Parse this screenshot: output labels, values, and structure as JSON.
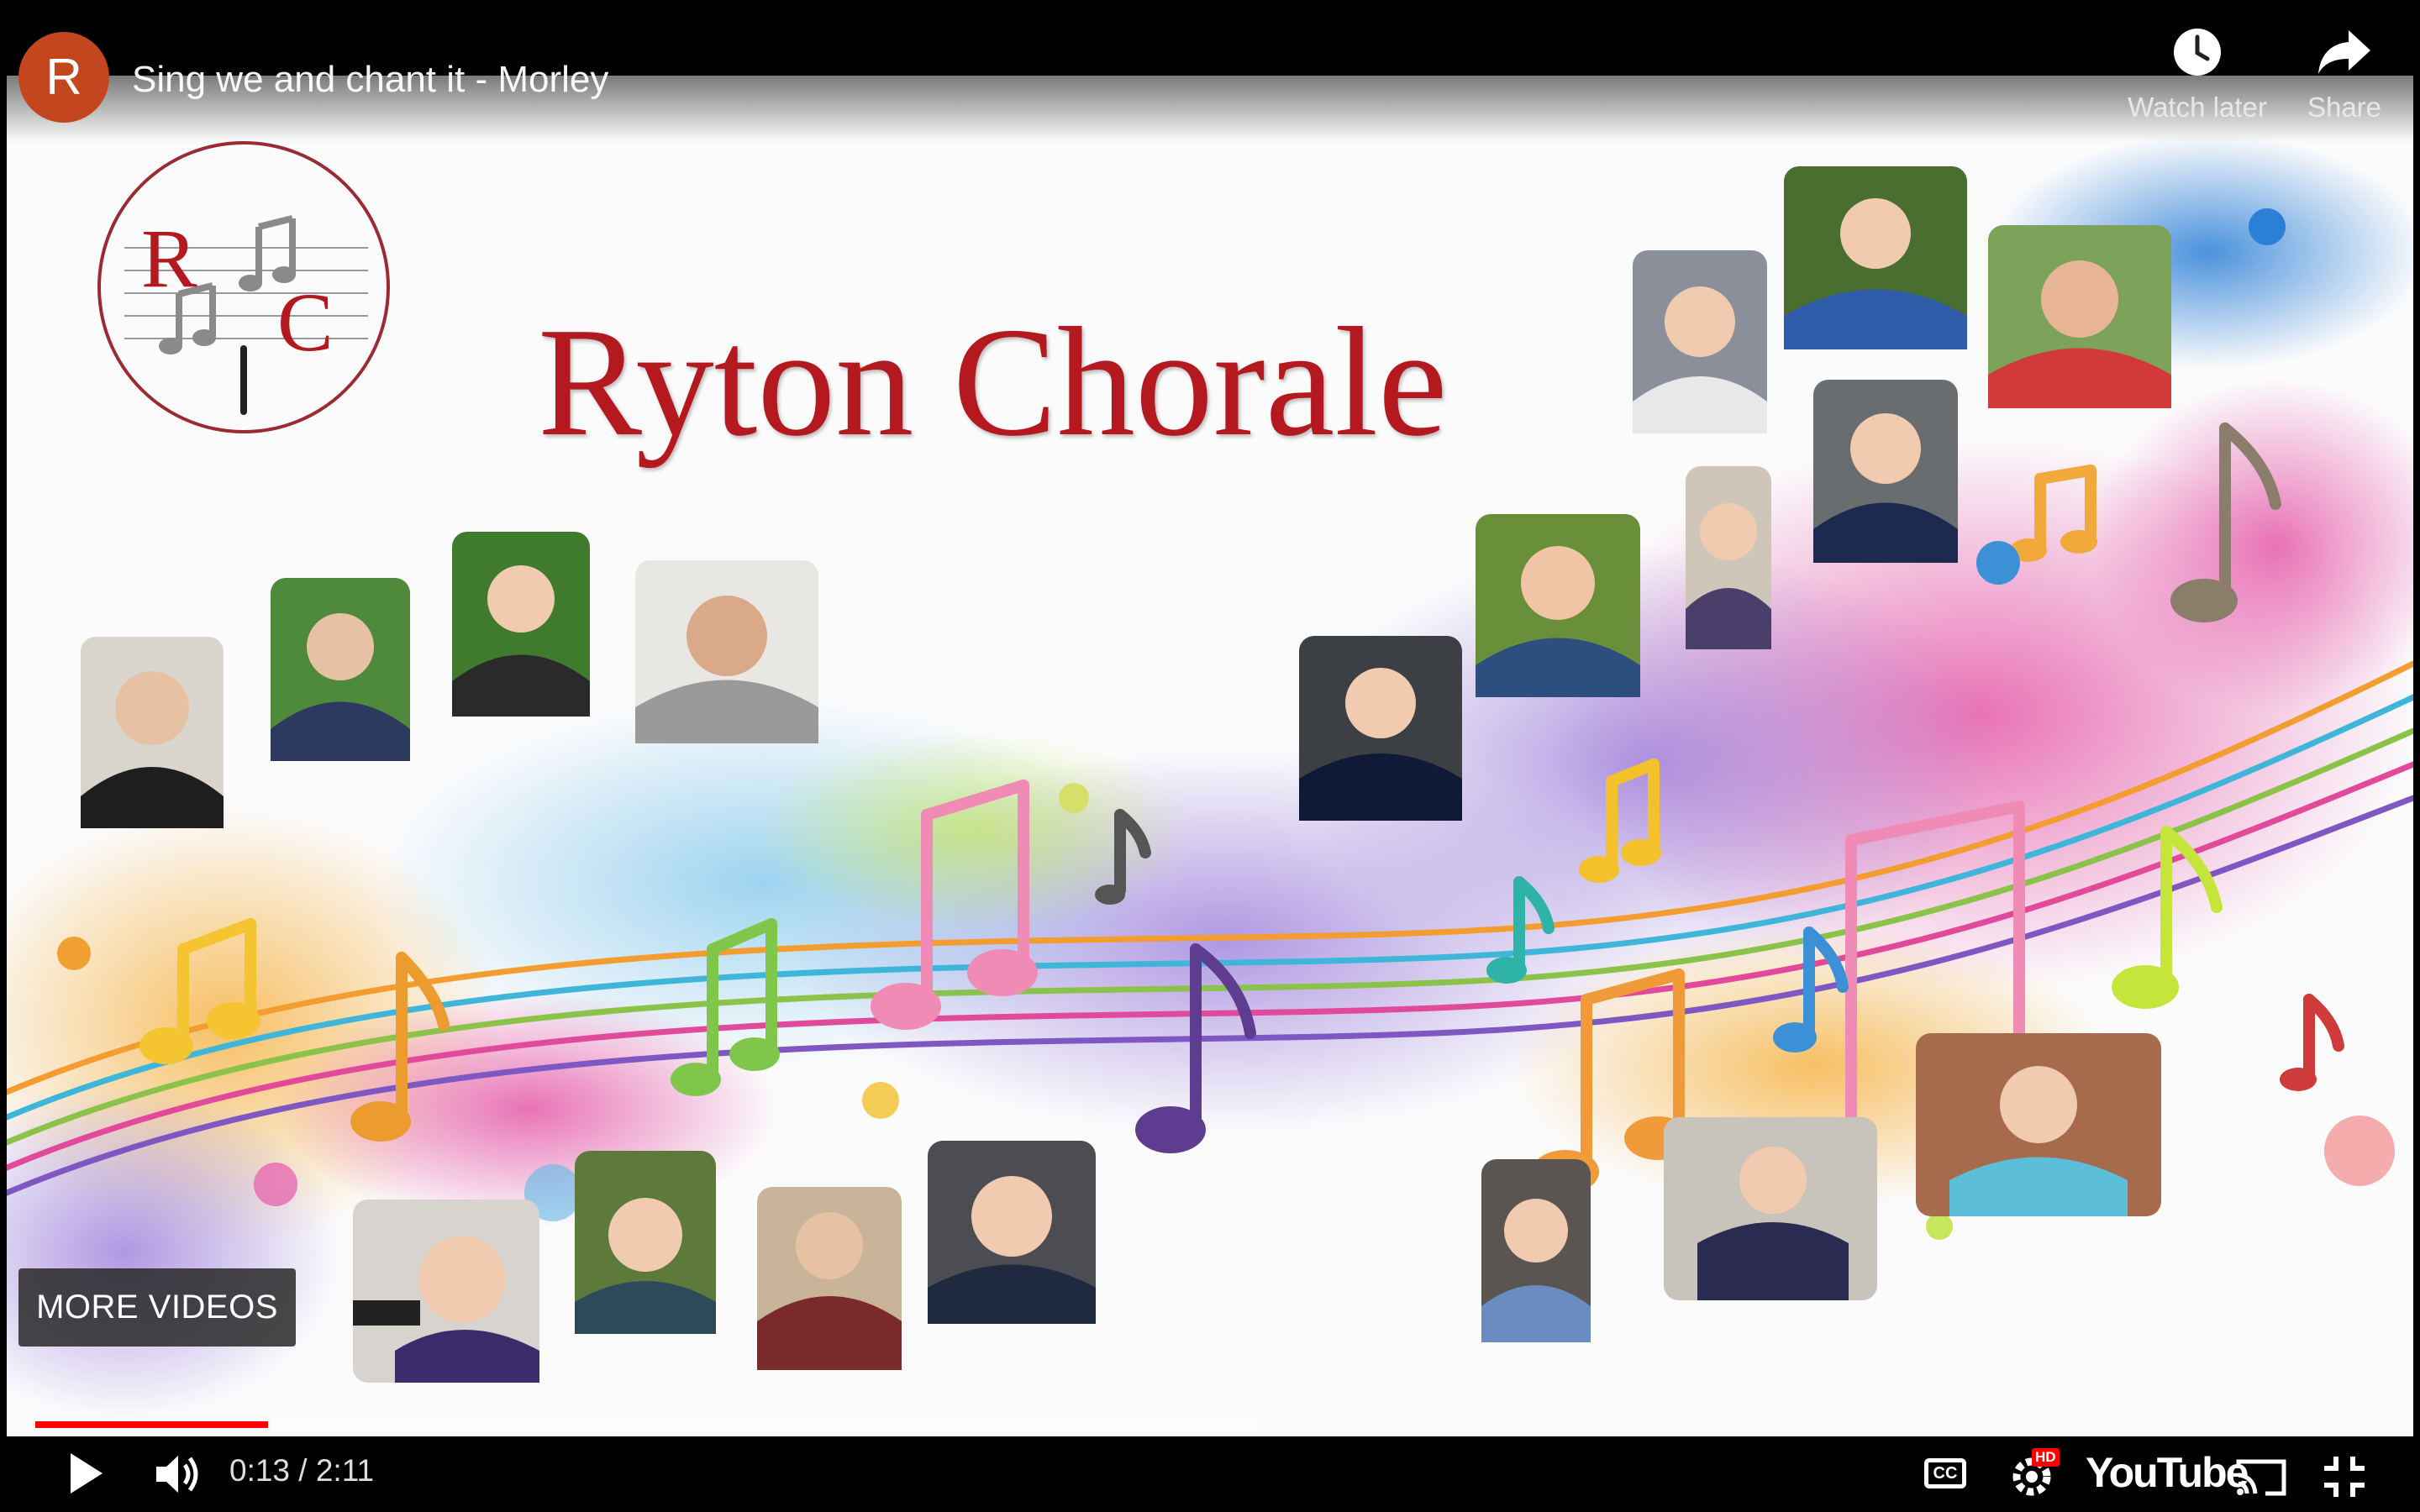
{
  "channel": {
    "avatar_letter": "R",
    "avatar_color": "#c3461f"
  },
  "video": {
    "title": "Sing we and chant it - Morley"
  },
  "top_actions": {
    "watch_later": "Watch later",
    "share": "Share"
  },
  "slide": {
    "heading": "Ryton Chorale",
    "heading_color": "#b3191f",
    "logo_letters": {
      "top": "R",
      "bottom": "C"
    }
  },
  "overlay": {
    "more_videos": "MORE VIDEOS"
  },
  "progress": {
    "played_fraction": 0.0992,
    "loaded_fraction": 0.52,
    "played_color": "#ff0000"
  },
  "controls": {
    "current_time": "0:13",
    "separator": " / ",
    "duration": "2:11",
    "youtube_label": "YouTube",
    "hd_badge": "HD",
    "cc_label": "CC"
  }
}
